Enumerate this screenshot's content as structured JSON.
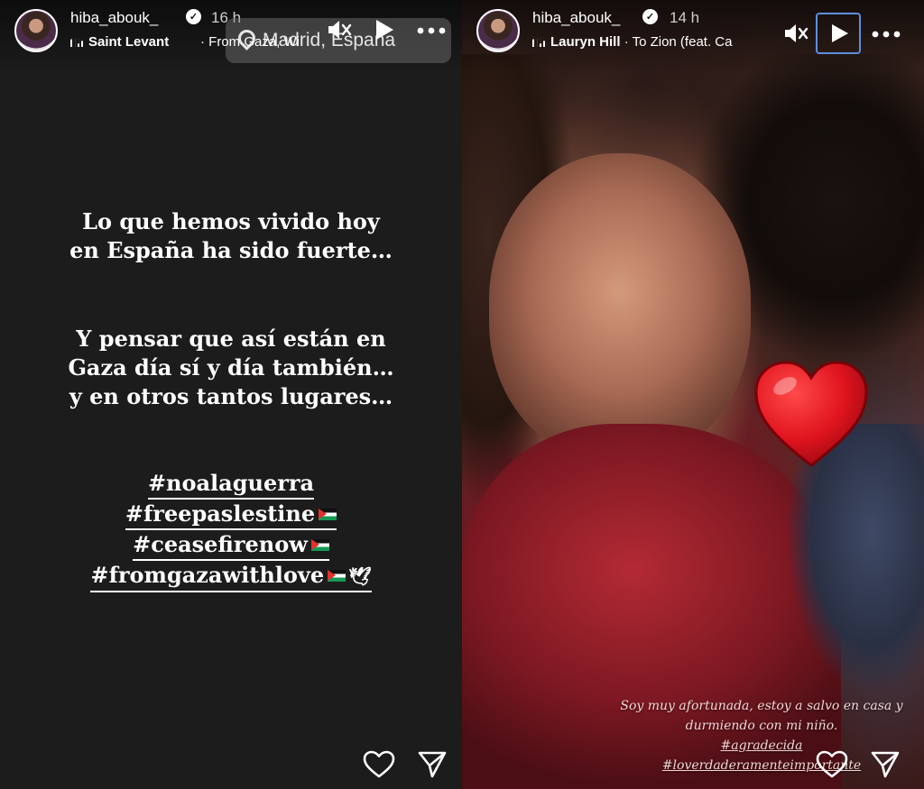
{
  "left_story": {
    "username": "hiba_abouk_",
    "time": "16 h",
    "music_artist": "Saint Levant",
    "music_track": "· From Gaza, Wi",
    "location": "Madrid, España",
    "paragraph1": [
      "Lo que hemos vivido hoy",
      "en España ha sido fuerte…"
    ],
    "paragraph2": [
      "Y pensar que así están en",
      "Gaza día sí y día también…",
      "y en otros tantos lugares…"
    ],
    "hashtags": [
      "#noalaguerra",
      "#freepaslestine",
      "#ceasefirenow",
      "#fromgazawithlove"
    ]
  },
  "right_story": {
    "username": "hiba_abouk_",
    "time": "14 h",
    "music_artist": "Lauryn Hill",
    "music_track": "· To Zion (feat. Ca",
    "caption_line1": "Soy muy afortunada, estoy a salvo en casa y",
    "caption_line2": "durmiendo con mi niño.",
    "caption_tag1": "#agradecida",
    "caption_tag2": "#loverdaderamenteimportante"
  },
  "icons": {
    "mute": "speaker-muted-icon",
    "play": "play-icon",
    "more": "more-options-icon",
    "like": "heart-icon",
    "share": "send-icon",
    "verified": "verified-badge-icon",
    "location": "location-pin-icon",
    "music": "music-bars-icon",
    "sticker": "red-heart-sticker"
  },
  "colors": {
    "left_background": "#1c1c1c",
    "play_focus_border": "#5b8fe0",
    "heart_sticker": "#e0141e"
  }
}
